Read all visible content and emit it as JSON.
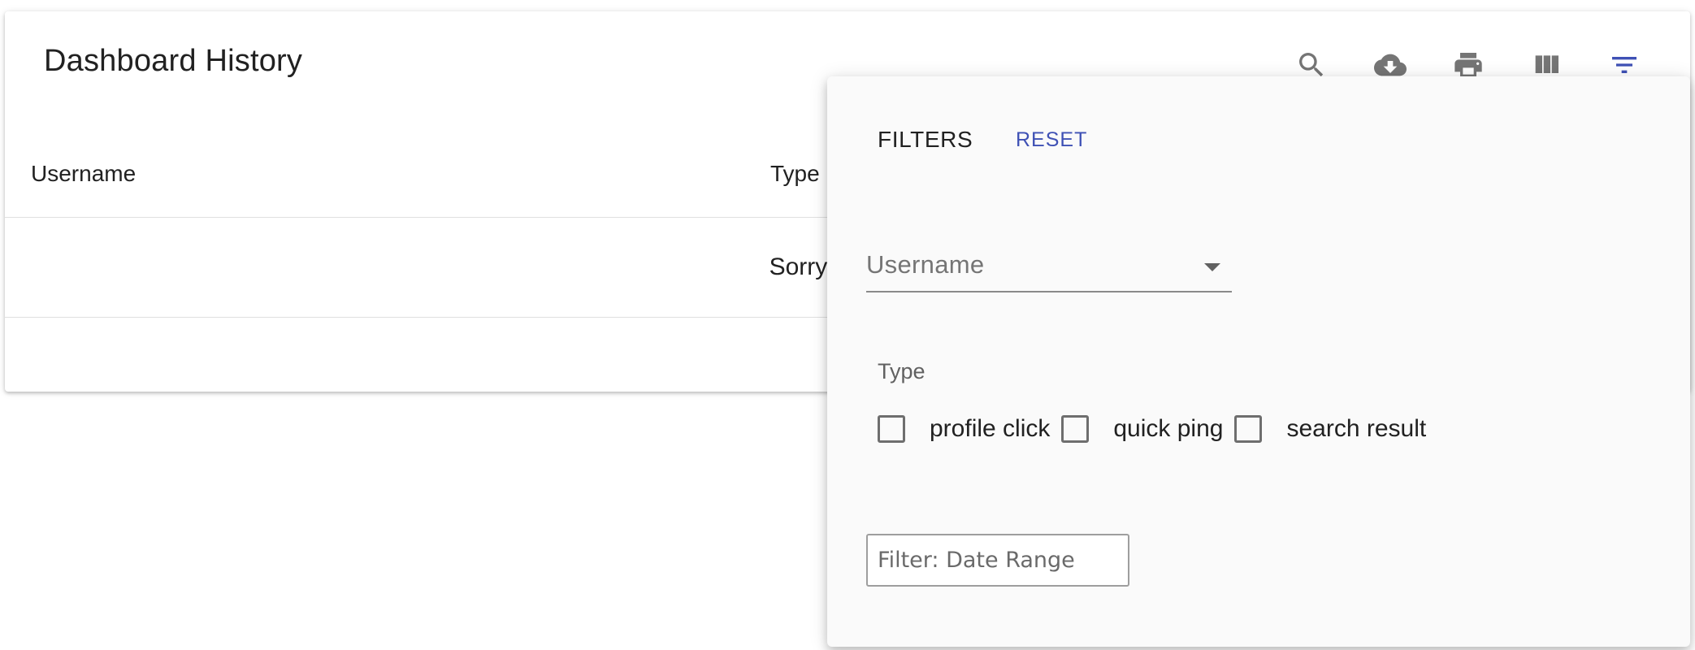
{
  "page": {
    "title": "Dashboard History"
  },
  "toolbar": {
    "icons": [
      "search-icon",
      "cloud-download-icon",
      "print-icon",
      "view-column-icon",
      "filter-list-icon"
    ],
    "active_color": "#3f51b5",
    "icon_color": "#757575"
  },
  "table": {
    "columns": [
      "Username",
      "Type"
    ],
    "empty_message": "Sorry, no matc"
  },
  "filters": {
    "title": "FILTERS",
    "reset_label": "RESET",
    "username_select": {
      "label": "Username",
      "value": ""
    },
    "type_group": {
      "label": "Type",
      "options": [
        {
          "label": "profile click",
          "checked": false
        },
        {
          "label": "quick ping",
          "checked": false
        },
        {
          "label": "search result",
          "checked": false
        }
      ]
    },
    "date_range": {
      "placeholder": "Filter: Date Range",
      "value": ""
    }
  }
}
